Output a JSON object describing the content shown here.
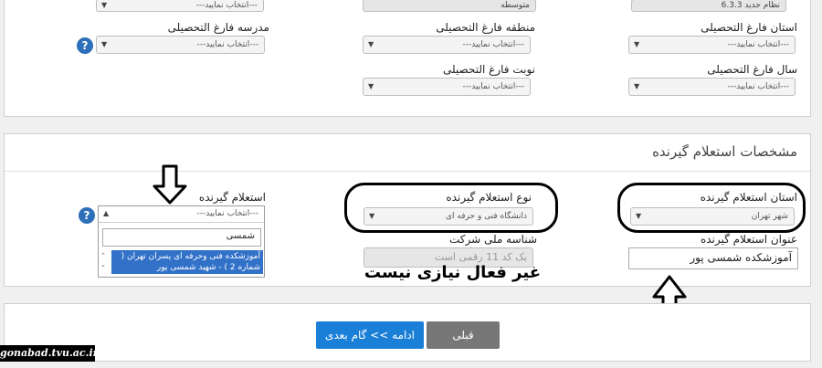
{
  "top": {
    "row0": {
      "right_value": "نظام جدید 6.3.3",
      "middle_value": "متوسطه",
      "left_value": "---انتخاب نمایید---"
    },
    "row1": {
      "right_label": "استان فارغ التحصیلی",
      "right_value": "---انتخاب نمایید---",
      "middle_label": "منطقه فارغ التحصیلی",
      "middle_value": "---انتخاب نمایید---",
      "left_label": "مدرسه فارغ التحصیلی",
      "left_value": "---انتخاب نمایید---"
    },
    "row2": {
      "right_label": "سال فارغ التحصیلی",
      "right_value": "---انتخاب نمایید---",
      "middle_label": "نوبت فارغ التحصیلی",
      "middle_value": "---انتخاب نمایید---"
    },
    "help": "?"
  },
  "receiver": {
    "section_title": "مشخصات استعلام گیرنده",
    "province_label": "استان استعلام گیرنده",
    "province_value": "شهر تهران",
    "type_label": "نوع استعلام گیرنده",
    "type_value": "دانشگاه فنی و حرفه ای",
    "receiver_label": "استعلام گیرنده",
    "receiver_value": "---انتخاب نمایید---",
    "search_value": "شمسی",
    "option_text": "آموزشکده فنی وحرفه ای پسران تهران ( شماره 2 ) - شهید شمسی پور",
    "title_label": "عنوان استعلام گیرنده",
    "title_value": "آموزشکده شمسی پور",
    "national_id_label": "شناسه ملی شرکت",
    "national_id_placeholder": "یک کد 11 رقمی است",
    "annotation": "غیر فعال نیازی نیست",
    "help": "?"
  },
  "nav": {
    "prev_label": "قبلی",
    "next_label": "ادامه >> گام بعدی"
  },
  "watermark": "gonabad.tvu.ac.ir",
  "colors": {
    "primary": "#1a7fd6",
    "secondary": "#777777",
    "help": "#2d6fb8"
  }
}
